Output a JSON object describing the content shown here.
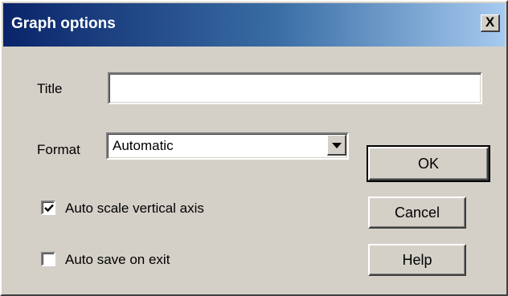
{
  "dialog": {
    "title": "Graph options",
    "close_label": "X"
  },
  "fields": {
    "title_label": "Title",
    "title_value": "",
    "format_label": "Format",
    "format_value": "Automatic"
  },
  "checkboxes": [
    {
      "label": "Auto scale vertical axis",
      "checked": true
    },
    {
      "label": "Auto save on exit",
      "checked": false
    }
  ],
  "buttons": {
    "ok": "OK",
    "cancel": "Cancel",
    "help": "Help"
  },
  "icons": {
    "close": "close-icon",
    "dropdown": "chevron-down-icon",
    "check": "checkmark-icon"
  }
}
